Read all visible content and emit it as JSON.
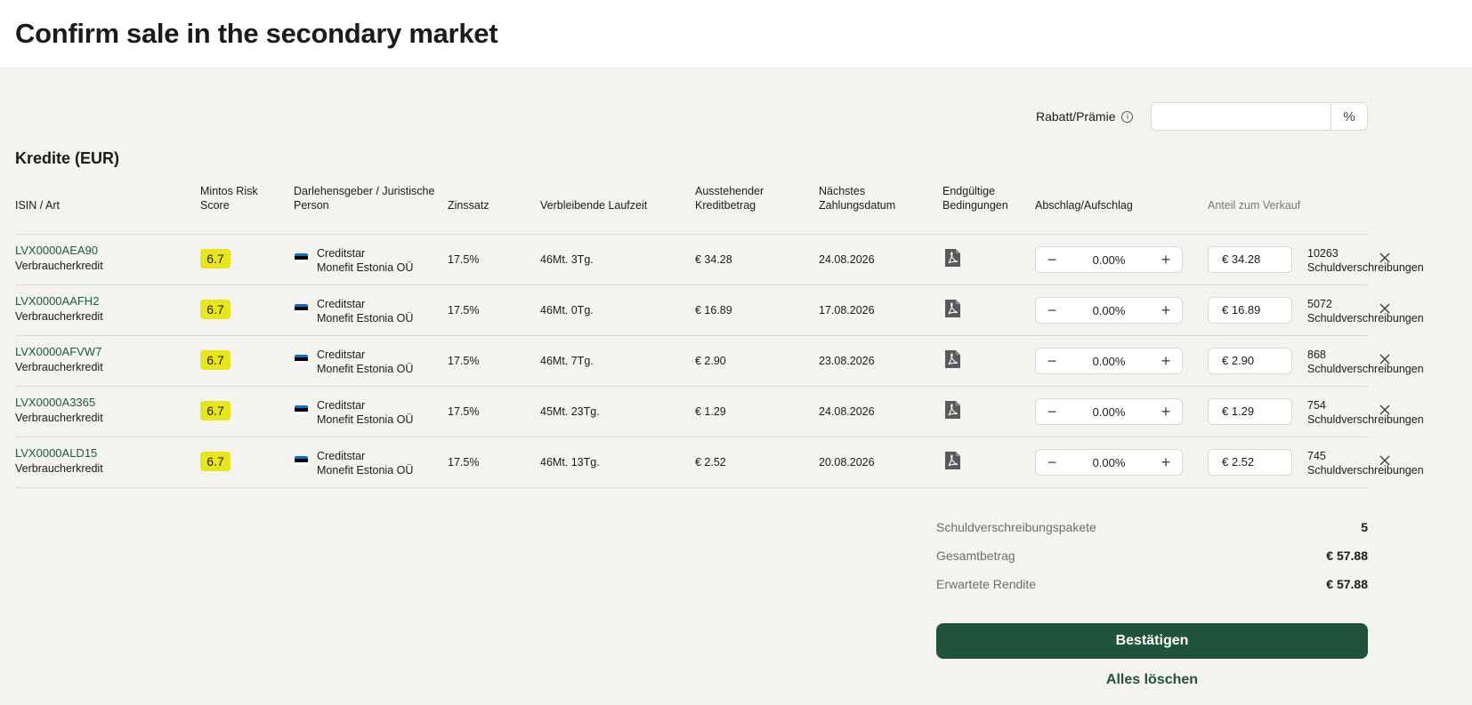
{
  "header": {
    "title": "Confirm sale in the secondary market"
  },
  "discount": {
    "label": "Rabatt/Prämie",
    "info_icon": "info-icon",
    "value": "",
    "unit": "%"
  },
  "section_title": "Kredite (EUR)",
  "columns": {
    "isin": "ISIN / Art",
    "risk_line1": "Mintos Risk",
    "risk_line2": "Score",
    "lender_line1": "Darlehensgeber / Juristische",
    "lender_line2": "Person",
    "rate": "Zinssatz",
    "term": "Verbleibende Laufzeit",
    "amount_line1": "Ausstehender",
    "amount_line2": "Kreditbetrag",
    "date_line1": "Nächstes",
    "date_line2": "Zahlungsdatum",
    "terms_line1": "Endgültige",
    "terms_line2": "Bedingungen",
    "markup": "Abschlag/Aufschlag",
    "share": "Anteil zum Verkauf"
  },
  "rows": [
    {
      "isin": "LVX0000AEA90",
      "type": "Verbraucherkredit",
      "risk": "6.7",
      "lender": "Creditstar",
      "entity": "Monefit Estonia OÜ",
      "rate": "17.5%",
      "term": "46Mt. 3Tg.",
      "amount": "€ 34.28",
      "date": "24.08.2026",
      "markup": "0.00%",
      "price": "€ 34.28",
      "notes": "10263",
      "notes_label": "Schuldverschreibungen"
    },
    {
      "isin": "LVX0000AAFH2",
      "type": "Verbraucherkredit",
      "risk": "6.7",
      "lender": "Creditstar",
      "entity": "Monefit Estonia OÜ",
      "rate": "17.5%",
      "term": "46Mt. 0Tg.",
      "amount": "€ 16.89",
      "date": "17.08.2026",
      "markup": "0.00%",
      "price": "€ 16.89",
      "notes": "5072",
      "notes_label": "Schuldverschreibungen"
    },
    {
      "isin": "LVX0000AFVW7",
      "type": "Verbraucherkredit",
      "risk": "6.7",
      "lender": "Creditstar",
      "entity": "Monefit Estonia OÜ",
      "rate": "17.5%",
      "term": "46Mt. 7Tg.",
      "amount": "€ 2.90",
      "date": "23.08.2026",
      "markup": "0.00%",
      "price": "€ 2.90",
      "notes": "868",
      "notes_label": "Schuldverschreibungen"
    },
    {
      "isin": "LVX0000A3365",
      "type": "Verbraucherkredit",
      "risk": "6.7",
      "lender": "Creditstar",
      "entity": "Monefit Estonia OÜ",
      "rate": "17.5%",
      "term": "45Mt. 23Tg.",
      "amount": "€ 1.29",
      "date": "24.08.2026",
      "markup": "0.00%",
      "price": "€ 1.29",
      "notes": "754",
      "notes_label": "Schuldverschreibungen"
    },
    {
      "isin": "LVX0000ALD15",
      "type": "Verbraucherkredit",
      "risk": "6.7",
      "lender": "Creditstar",
      "entity": "Monefit Estonia OÜ",
      "rate": "17.5%",
      "term": "46Mt. 13Tg.",
      "amount": "€ 2.52",
      "date": "20.08.2026",
      "markup": "0.00%",
      "price": "€ 2.52",
      "notes": "745",
      "notes_label": "Schuldverschreibungen"
    }
  ],
  "icons": {
    "flag": "estonia-flag-icon",
    "terms": "pdf-icon",
    "minus": "minus-icon",
    "plus": "plus-icon",
    "remove": "close-icon"
  },
  "stepper": {
    "minus": "−",
    "plus": "+"
  },
  "colors": {
    "accent": "#21523a",
    "risk_badge": "#e8e61a",
    "link": "#1f5a3a",
    "flag": [
      "#0072ce",
      "#000000",
      "#ffffff"
    ]
  },
  "summary": {
    "packages_label": "Schuldverschreibungspakete",
    "packages_value": "5",
    "total_label": "Gesamtbetrag",
    "total_value": "€ 57.88",
    "return_label": "Erwartete Rendite",
    "return_value": "€ 57.88"
  },
  "actions": {
    "confirm": "Bestätigen",
    "clear": "Alles löschen"
  }
}
